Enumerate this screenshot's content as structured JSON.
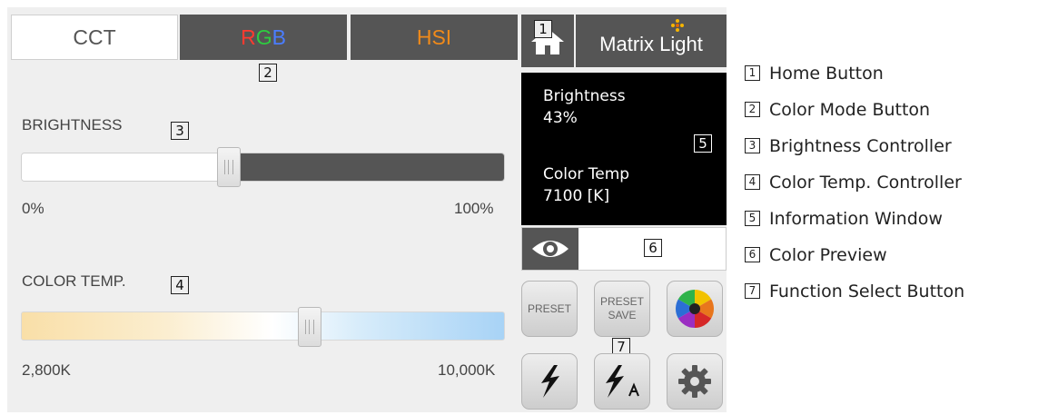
{
  "tabs": {
    "cct": "CCT",
    "rgb": [
      "R",
      "G",
      "B"
    ],
    "hsi": "HSI"
  },
  "brightness": {
    "label": "BRIGHTNESS",
    "min_label": "0%",
    "max_label": "100%",
    "level": 0.43
  },
  "color_temp": {
    "label": "COLOR TEMP.",
    "min_label": "2,800K",
    "max_label": "10,000K",
    "level_value_k": 7100
  },
  "header": {
    "logo_text": "Matrix Light"
  },
  "info_window": {
    "brightness_label": "Brightness",
    "brightness_value": "43%",
    "color_temp_label": "Color Temp",
    "color_temp_value": "7100  [K]"
  },
  "function_buttons": {
    "preset": "PRESET",
    "preset_save_line1": "PRESET",
    "preset_save_line2": "SAVE"
  },
  "markers": [
    "1",
    "2",
    "3",
    "4",
    "5",
    "6",
    "7"
  ],
  "legend": [
    {
      "num": "1",
      "text": "Home Button"
    },
    {
      "num": "2",
      "text": "Color Mode Button"
    },
    {
      "num": "3",
      "text": "Brightness Controller"
    },
    {
      "num": "4",
      "text": "Color Temp. Controller"
    },
    {
      "num": "5",
      "text": "Information Window"
    },
    {
      "num": "6",
      "text": "Color Preview"
    },
    {
      "num": "7",
      "text": "Function Select Button"
    }
  ],
  "icons": [
    "home-icon",
    "eye-icon",
    "color-wheel-icon",
    "lightning-icon",
    "lightning-effect-icon",
    "gear-icon",
    "logo-dots-icon"
  ],
  "colors": {
    "dark_panel": "#555555",
    "rgb_r": "#ff3b30",
    "rgb_g": "#2ecc40",
    "rgb_b": "#4a7dff",
    "hsi": "#f08a1a"
  }
}
